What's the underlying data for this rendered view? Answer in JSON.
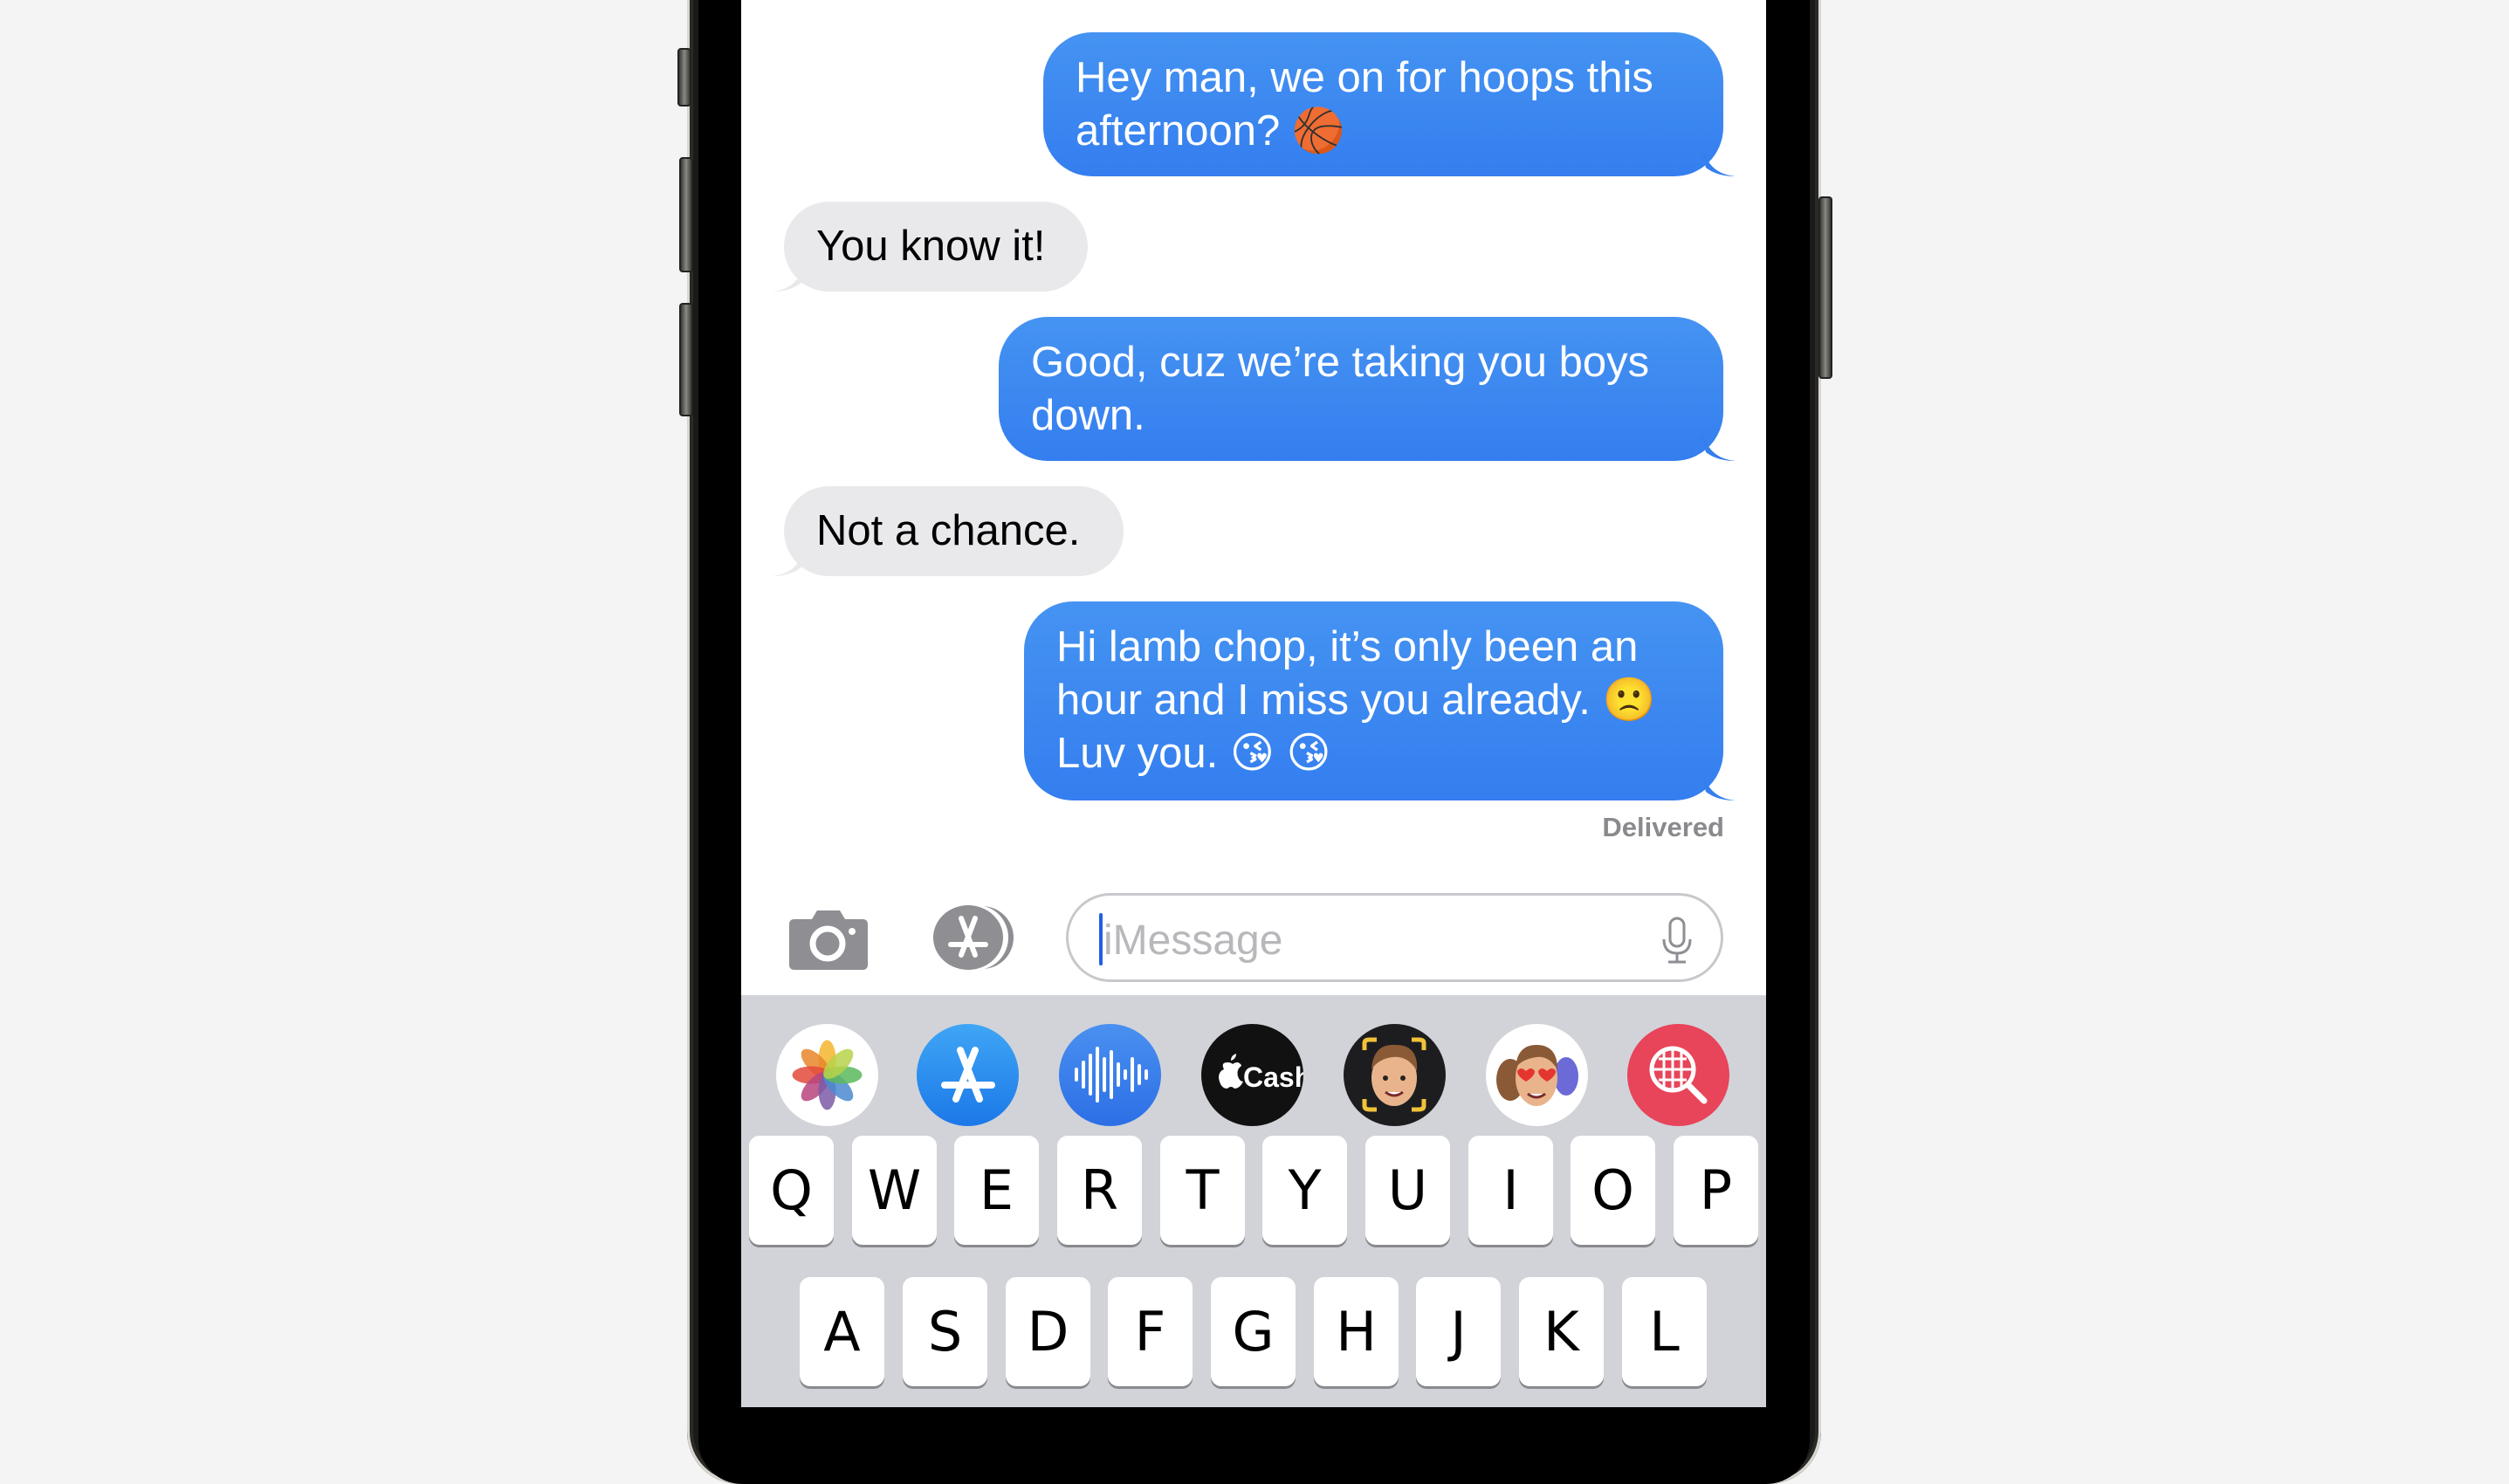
{
  "messages": [
    {
      "direction": "sent",
      "lines": [
        "Hey man, we on for hoops this",
        "afternoon? 🏀"
      ]
    },
    {
      "direction": "received",
      "lines": [
        "You know it!"
      ]
    },
    {
      "direction": "sent",
      "lines": [
        "Good, cuz we’re taking you boys",
        "down."
      ]
    },
    {
      "direction": "received",
      "lines": [
        "Not a chance."
      ]
    },
    {
      "direction": "sent",
      "lines": [
        "Hi lamb chop, it’s only been an",
        "hour and I miss you already. 🙁",
        "Luv you. 😘 😘"
      ]
    }
  ],
  "status": "Delivered",
  "composer": {
    "placeholder": "iMessage",
    "camera_icon": "camera-icon",
    "apps_icon": "app-store-icon",
    "mic_icon": "microphone-icon"
  },
  "app_strip": [
    {
      "name": "photos-app",
      "icon": "photos-icon"
    },
    {
      "name": "app-store-app",
      "icon": "app-store-icon"
    },
    {
      "name": "audio-message-app",
      "icon": "waveform-icon"
    },
    {
      "name": "apple-cash-app",
      "icon": "apple-cash-icon",
      "label": "Cash"
    },
    {
      "name": "memoji-app",
      "icon": "memoji-icon"
    },
    {
      "name": "memoji-stickers-app",
      "icon": "memoji-stickers-icon"
    },
    {
      "name": "images-search-app",
      "icon": "globe-search-icon"
    }
  ],
  "keyboard": {
    "row1": [
      "Q",
      "W",
      "E",
      "R",
      "T",
      "Y",
      "U",
      "I",
      "O",
      "P"
    ],
    "row2": [
      "A",
      "S",
      "D",
      "F",
      "G",
      "H",
      "J",
      "K",
      "L"
    ]
  },
  "colors": {
    "sent_bubble": "#3a84f0",
    "received_bubble": "#e9e9eb",
    "keyboard_bg": "#d1d3d9",
    "caret": "#2160e3",
    "images_app": "#e8445a"
  }
}
